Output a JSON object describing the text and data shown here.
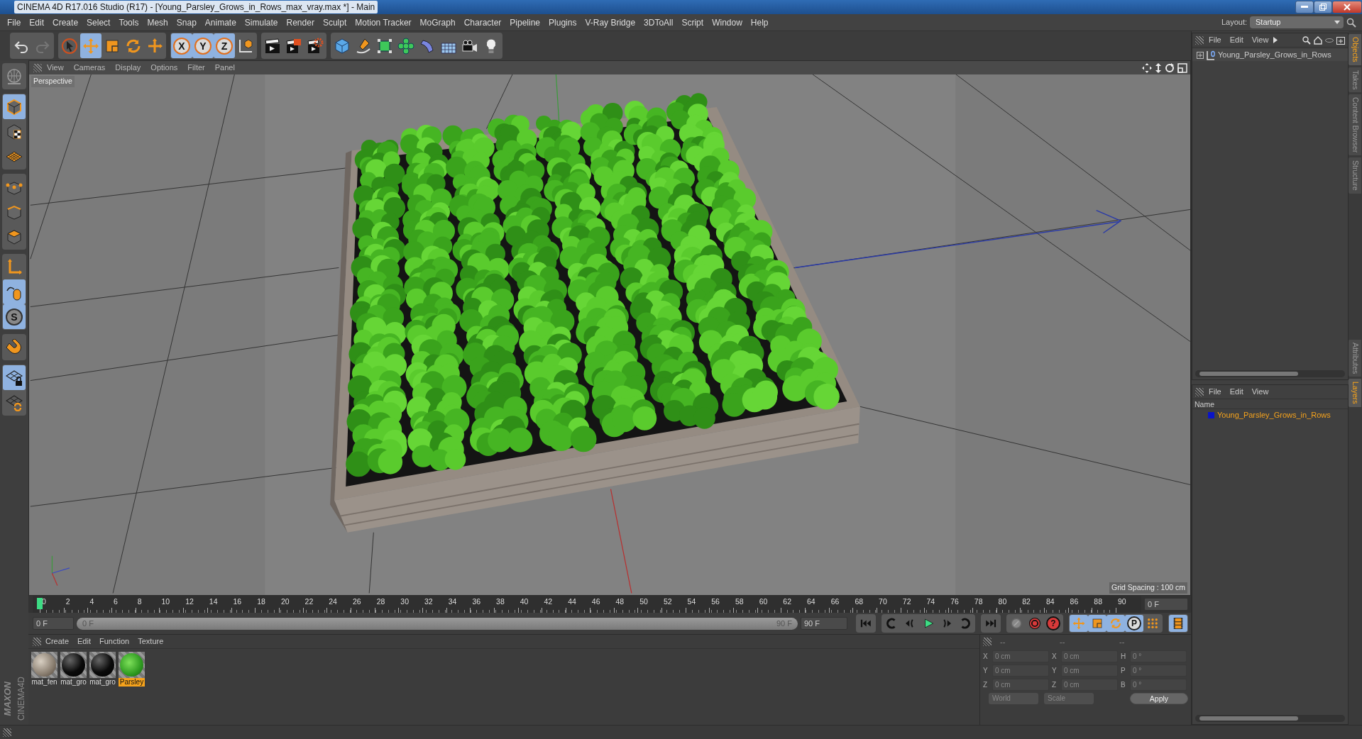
{
  "window": {
    "title": "CINEMA 4D R17.016 Studio (R17) - [Young_Parsley_Grows_in_Rows_max_vray.max *] - Main"
  },
  "menu_bar": [
    "File",
    "Edit",
    "Create",
    "Select",
    "Tools",
    "Mesh",
    "Snap",
    "Animate",
    "Simulate",
    "Render",
    "Sculpt",
    "Motion Tracker",
    "MoGraph",
    "Character",
    "Pipeline",
    "Plugins",
    "V-Ray Bridge",
    "3DToAll",
    "Script",
    "Window",
    "Help"
  ],
  "layout": {
    "label": "Layout:",
    "value": "Startup"
  },
  "toolbar_groups": [
    {
      "buttons": [
        {
          "kind": "undo",
          "active": false,
          "disabled": false
        },
        {
          "kind": "redo",
          "active": false,
          "disabled": true
        }
      ]
    },
    {
      "buttons": [
        {
          "kind": "select",
          "active": false,
          "disabled": false
        },
        {
          "kind": "move",
          "active": true,
          "disabled": false
        },
        {
          "kind": "scale",
          "active": false,
          "disabled": false
        },
        {
          "kind": "rotate",
          "active": false,
          "disabled": false
        },
        {
          "kind": "add",
          "active": false,
          "disabled": false
        }
      ]
    },
    {
      "buttons": [
        {
          "kind": "axis-letter",
          "label": "X",
          "active": true,
          "disabled": false
        },
        {
          "kind": "axis-letter",
          "label": "Y",
          "active": true,
          "disabled": false
        },
        {
          "kind": "axis-letter",
          "label": "Z",
          "active": true,
          "disabled": false
        },
        {
          "kind": "coord",
          "active": false,
          "disabled": false
        }
      ]
    },
    {
      "buttons": [
        {
          "kind": "render-view",
          "active": false,
          "disabled": false
        },
        {
          "kind": "render-picture",
          "active": false,
          "disabled": false
        },
        {
          "kind": "render-settings",
          "active": false,
          "disabled": false
        }
      ]
    },
    {
      "buttons": [
        {
          "kind": "cube",
          "active": false,
          "disabled": false
        },
        {
          "kind": "pen",
          "active": false,
          "disabled": false
        },
        {
          "kind": "subdivide",
          "active": false,
          "disabled": false
        },
        {
          "kind": "cloner",
          "active": false,
          "disabled": false
        },
        {
          "kind": "deformer",
          "active": false,
          "disabled": false
        },
        {
          "kind": "floor",
          "active": false,
          "disabled": false
        },
        {
          "kind": "camera",
          "active": false,
          "disabled": false
        },
        {
          "kind": "light",
          "active": false,
          "disabled": false
        }
      ]
    }
  ],
  "tool_groups": [
    {
      "buttons": [
        {
          "kind": "globe",
          "active": false
        }
      ]
    },
    {
      "buttons": [
        {
          "kind": "model",
          "active": true
        },
        {
          "kind": "texture",
          "active": false
        },
        {
          "kind": "workplane",
          "active": false
        }
      ]
    },
    {
      "buttons": [
        {
          "kind": "points",
          "active": false
        },
        {
          "kind": "edges",
          "active": false
        },
        {
          "kind": "polygons",
          "active": false
        }
      ]
    },
    {
      "buttons": [
        {
          "kind": "axis",
          "active": false
        },
        {
          "kind": "tweak",
          "active": true
        },
        {
          "kind": "letter",
          "label": "S",
          "active": true
        }
      ]
    },
    {
      "buttons": [
        {
          "kind": "magnet",
          "active": false
        }
      ]
    },
    {
      "buttons": [
        {
          "kind": "grid-lock",
          "active": true
        },
        {
          "kind": "grid-rotate",
          "active": false
        }
      ]
    }
  ],
  "brand": [
    "MAXON",
    "CINEMA4D"
  ],
  "viewport": {
    "menu": [
      "View",
      "Cameras",
      "Display",
      "Options",
      "Filter",
      "Panel"
    ],
    "label": "Perspective",
    "grid_spacing": "Grid Spacing : 100 cm"
  },
  "timeline": {
    "ticks": [
      "0",
      "2",
      "4",
      "6",
      "8",
      "10",
      "12",
      "14",
      "16",
      "18",
      "20",
      "22",
      "24",
      "26",
      "28",
      "30",
      "32",
      "34",
      "36",
      "38",
      "40",
      "42",
      "44",
      "46",
      "48",
      "50",
      "52",
      "54",
      "56",
      "58",
      "60",
      "62",
      "64",
      "66",
      "68",
      "70",
      "72",
      "74",
      "76",
      "78",
      "80",
      "82",
      "84",
      "86",
      "88",
      "90"
    ],
    "playhead": {
      "level": 0
    },
    "current_frame": "0 F",
    "start_field": "0 F",
    "range": {
      "level": 1
    },
    "range_start": "0 F",
    "range_end": "90 F",
    "end_field": "90 F"
  },
  "transport_groups": [
    {
      "buttons": [
        {
          "kind": "go-start",
          "active": false
        }
      ]
    },
    {
      "buttons": [
        {
          "kind": "prev-key",
          "active": false
        },
        {
          "kind": "prev-frame",
          "active": false
        },
        {
          "kind": "play",
          "active": false
        },
        {
          "kind": "next-frame",
          "active": false
        },
        {
          "kind": "next-key",
          "active": false
        }
      ]
    },
    {
      "buttons": [
        {
          "kind": "go-end",
          "active": false
        }
      ]
    },
    {
      "buttons": [
        {
          "kind": "record-off",
          "active": false
        },
        {
          "kind": "record",
          "active": false
        },
        {
          "kind": "help",
          "label": "?",
          "active": false
        }
      ]
    },
    {
      "buttons": [
        {
          "kind": "move",
          "active": true
        },
        {
          "kind": "scale",
          "active": true
        },
        {
          "kind": "rotate",
          "active": true
        },
        {
          "kind": "param",
          "label": "P",
          "active": true
        },
        {
          "kind": "dots",
          "active": false
        }
      ]
    },
    {
      "buttons": [
        {
          "kind": "film",
          "active": true
        }
      ]
    }
  ],
  "materials": {
    "menu": [
      "Create",
      "Edit",
      "Function",
      "Texture"
    ],
    "items": [
      {
        "name": "mat_fen",
        "kind": "wood",
        "selected": false
      },
      {
        "name": "mat_gro",
        "kind": "black",
        "selected": false
      },
      {
        "name": "mat_gro",
        "kind": "black",
        "selected": false
      },
      {
        "name": "Parsley",
        "kind": "leaf",
        "selected": true
      }
    ]
  },
  "coordinates": {
    "headers": [
      "--",
      "--",
      "--"
    ],
    "rows": [
      {
        "cells": [
          {
            "axis": "X",
            "value": "0 cm"
          },
          {
            "axis": "X",
            "value": "0 cm"
          },
          {
            "axis": "H",
            "value": "0 °"
          }
        ]
      },
      {
        "cells": [
          {
            "axis": "Y",
            "value": "0 cm"
          },
          {
            "axis": "Y",
            "value": "0 cm"
          },
          {
            "axis": "P",
            "value": "0 °"
          }
        ]
      },
      {
        "cells": [
          {
            "axis": "Z",
            "value": "0 cm"
          },
          {
            "axis": "Z",
            "value": "0 cm"
          },
          {
            "axis": "B",
            "value": "0 °"
          }
        ]
      }
    ],
    "space": "World",
    "mode": "Scale",
    "apply": "Apply"
  },
  "objects_panel": {
    "menu": [
      "File",
      "Edit",
      "View"
    ],
    "items": [
      {
        "name": "Young_Parsley_Grows_in_Rows"
      }
    ]
  },
  "layers_panel": {
    "menu": [
      "File",
      "Edit",
      "View"
    ],
    "column": "Name",
    "items": [
      {
        "name": "Young_Parsley_Grows_in_Rows",
        "color": "#0a14c8"
      }
    ]
  },
  "side_tabs_top": [
    {
      "label": "Objects",
      "selected": true
    },
    {
      "label": "Takes",
      "selected": false
    },
    {
      "label": "Content Browser",
      "selected": false
    },
    {
      "label": "Structure",
      "selected": false
    }
  ],
  "side_tabs_bottom": [
    {
      "label": "Attributes",
      "selected": false
    },
    {
      "label": "Layers",
      "selected": true
    }
  ]
}
